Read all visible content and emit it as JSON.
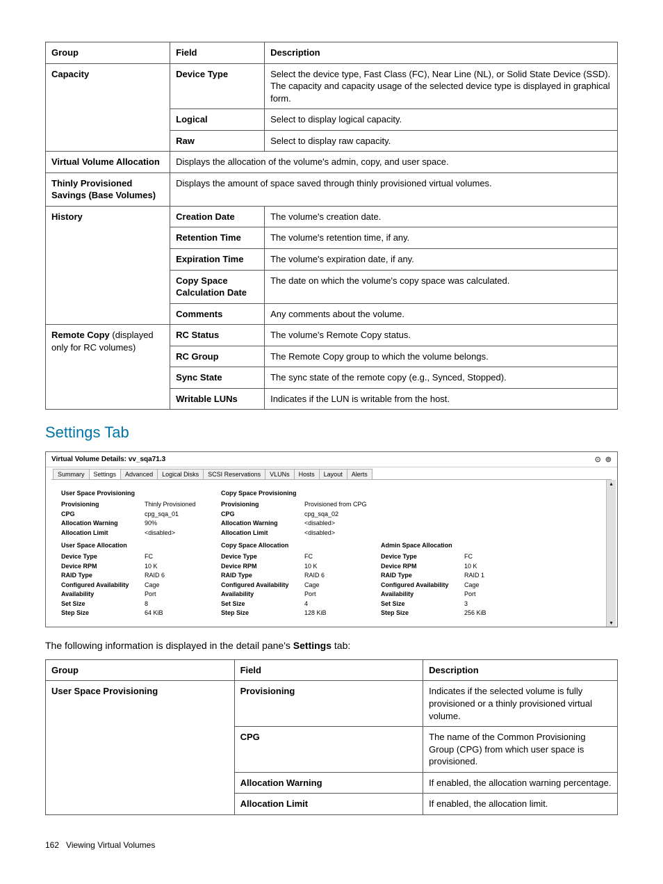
{
  "table1": {
    "headers": [
      "Group",
      "Field",
      "Description"
    ],
    "rows": [
      {
        "group": "Capacity",
        "groupRowspan": 3,
        "field": "Device Type",
        "desc": "Select the device type, Fast Class (FC), Near Line (NL), or Solid State Device (SSD). The capacity and capacity usage of the selected device type is displayed in graphical form."
      },
      {
        "field": "Logical",
        "desc": "Select to display logical capacity."
      },
      {
        "field": "Raw",
        "desc": "Select to display raw capacity."
      },
      {
        "group": "Virtual Volume Allocation",
        "fullDesc": "Displays the allocation of the volume's admin, copy, and user space."
      },
      {
        "group": "Thinly Provisioned Savings (Base Volumes)",
        "fullDesc": "Displays the amount of space saved through thinly provisioned virtual volumes."
      },
      {
        "group": "History",
        "groupRowspan": 5,
        "field": "Creation Date",
        "desc": "The volume's creation date."
      },
      {
        "field": "Retention Time",
        "desc": "The volume's retention time, if any."
      },
      {
        "field": "Expiration Time",
        "desc": "The volume's expiration date, if any."
      },
      {
        "field": "Copy Space Calculation Date",
        "desc": "The date on which the volume's copy space was calculated."
      },
      {
        "field": "Comments",
        "desc": "Any comments about the volume."
      },
      {
        "groupBold": "Remote Copy",
        "groupNorm": " (displayed only for RC volumes)",
        "groupRowspan": 4,
        "field": "RC Status",
        "desc": "The volume's Remote Copy status."
      },
      {
        "field": "RC Group",
        "desc": "The Remote Copy group to which the volume belongs."
      },
      {
        "field": "Sync State",
        "desc": "The sync state of the remote copy (e.g., Synced, Stopped)."
      },
      {
        "field": "Writable LUNs",
        "desc": "Indicates if the LUN is writable from the host."
      }
    ]
  },
  "sectionTitle": "Settings Tab",
  "screenshot": {
    "title": "Virtual Volume Details: vv_sqa71.3",
    "tabs": [
      "Summary",
      "Settings",
      "Advanced",
      "Logical Disks",
      "SCSI Reservations",
      "VLUNs",
      "Hosts",
      "Layout",
      "Alerts"
    ],
    "activeTab": "Settings",
    "usp": {
      "title": "User Space Provisioning",
      "items": [
        [
          "Provisioning",
          "Thinly Provisioned"
        ],
        [
          "CPG",
          "cpg_sqa_01"
        ],
        [
          "Allocation Warning",
          "90%"
        ],
        [
          "Allocation Limit",
          "<disabled>"
        ]
      ]
    },
    "csp": {
      "title": "Copy Space Provisioning",
      "items": [
        [
          "Provisioning",
          "Provisioned from CPG"
        ],
        [
          "CPG",
          "cpg_sqa_02"
        ],
        [
          "Allocation Warning",
          "<disabled>"
        ],
        [
          "Allocation Limit",
          "<disabled>"
        ]
      ]
    },
    "usa": {
      "title": "User Space Allocation",
      "items": [
        [
          "Device Type",
          "FC"
        ],
        [
          "Device RPM",
          "10 K"
        ],
        [
          "RAID Type",
          "RAID 6"
        ],
        [
          "Configured Availability",
          "Cage"
        ],
        [
          "Availability",
          "Port"
        ],
        [
          "Set Size",
          "8"
        ],
        [
          "Step Size",
          "64 KiB"
        ]
      ]
    },
    "csa": {
      "title": "Copy Space Allocation",
      "items": [
        [
          "Device Type",
          "FC"
        ],
        [
          "Device RPM",
          "10 K"
        ],
        [
          "RAID Type",
          "RAID 6"
        ],
        [
          "Configured Availability",
          "Cage"
        ],
        [
          "Availability",
          "Port"
        ],
        [
          "Set Size",
          "4"
        ],
        [
          "Step Size",
          "128 KiB"
        ]
      ]
    },
    "asa": {
      "title": "Admin Space Allocation",
      "items": [
        [
          "Device Type",
          "FC"
        ],
        [
          "Device RPM",
          "10 K"
        ],
        [
          "RAID Type",
          "RAID 1"
        ],
        [
          "Configured Availability",
          "Cage"
        ],
        [
          "Availability",
          "Port"
        ],
        [
          "Set Size",
          "3"
        ],
        [
          "Step Size",
          "256 KiB"
        ]
      ]
    }
  },
  "introPre": "The following information is displayed in the detail pane's ",
  "introBold": "Settings",
  "introPost": " tab:",
  "table2": {
    "headers": [
      "Group",
      "Field",
      "Description"
    ],
    "rows": [
      {
        "group": "User Space Provisioning",
        "groupRowspan": 4,
        "field": "Provisioning",
        "desc": "Indicates if the selected volume is fully provisioned or a thinly provisioned virtual volume."
      },
      {
        "field": "CPG",
        "desc": "The name of the Common Provisioning Group (CPG) from which user space is provisioned."
      },
      {
        "field": "Allocation Warning",
        "desc": "If enabled, the allocation warning percentage."
      },
      {
        "field": "Allocation Limit",
        "desc": "If enabled, the allocation limit."
      }
    ]
  },
  "footer": {
    "page": "162",
    "title": "Viewing Virtual Volumes"
  }
}
